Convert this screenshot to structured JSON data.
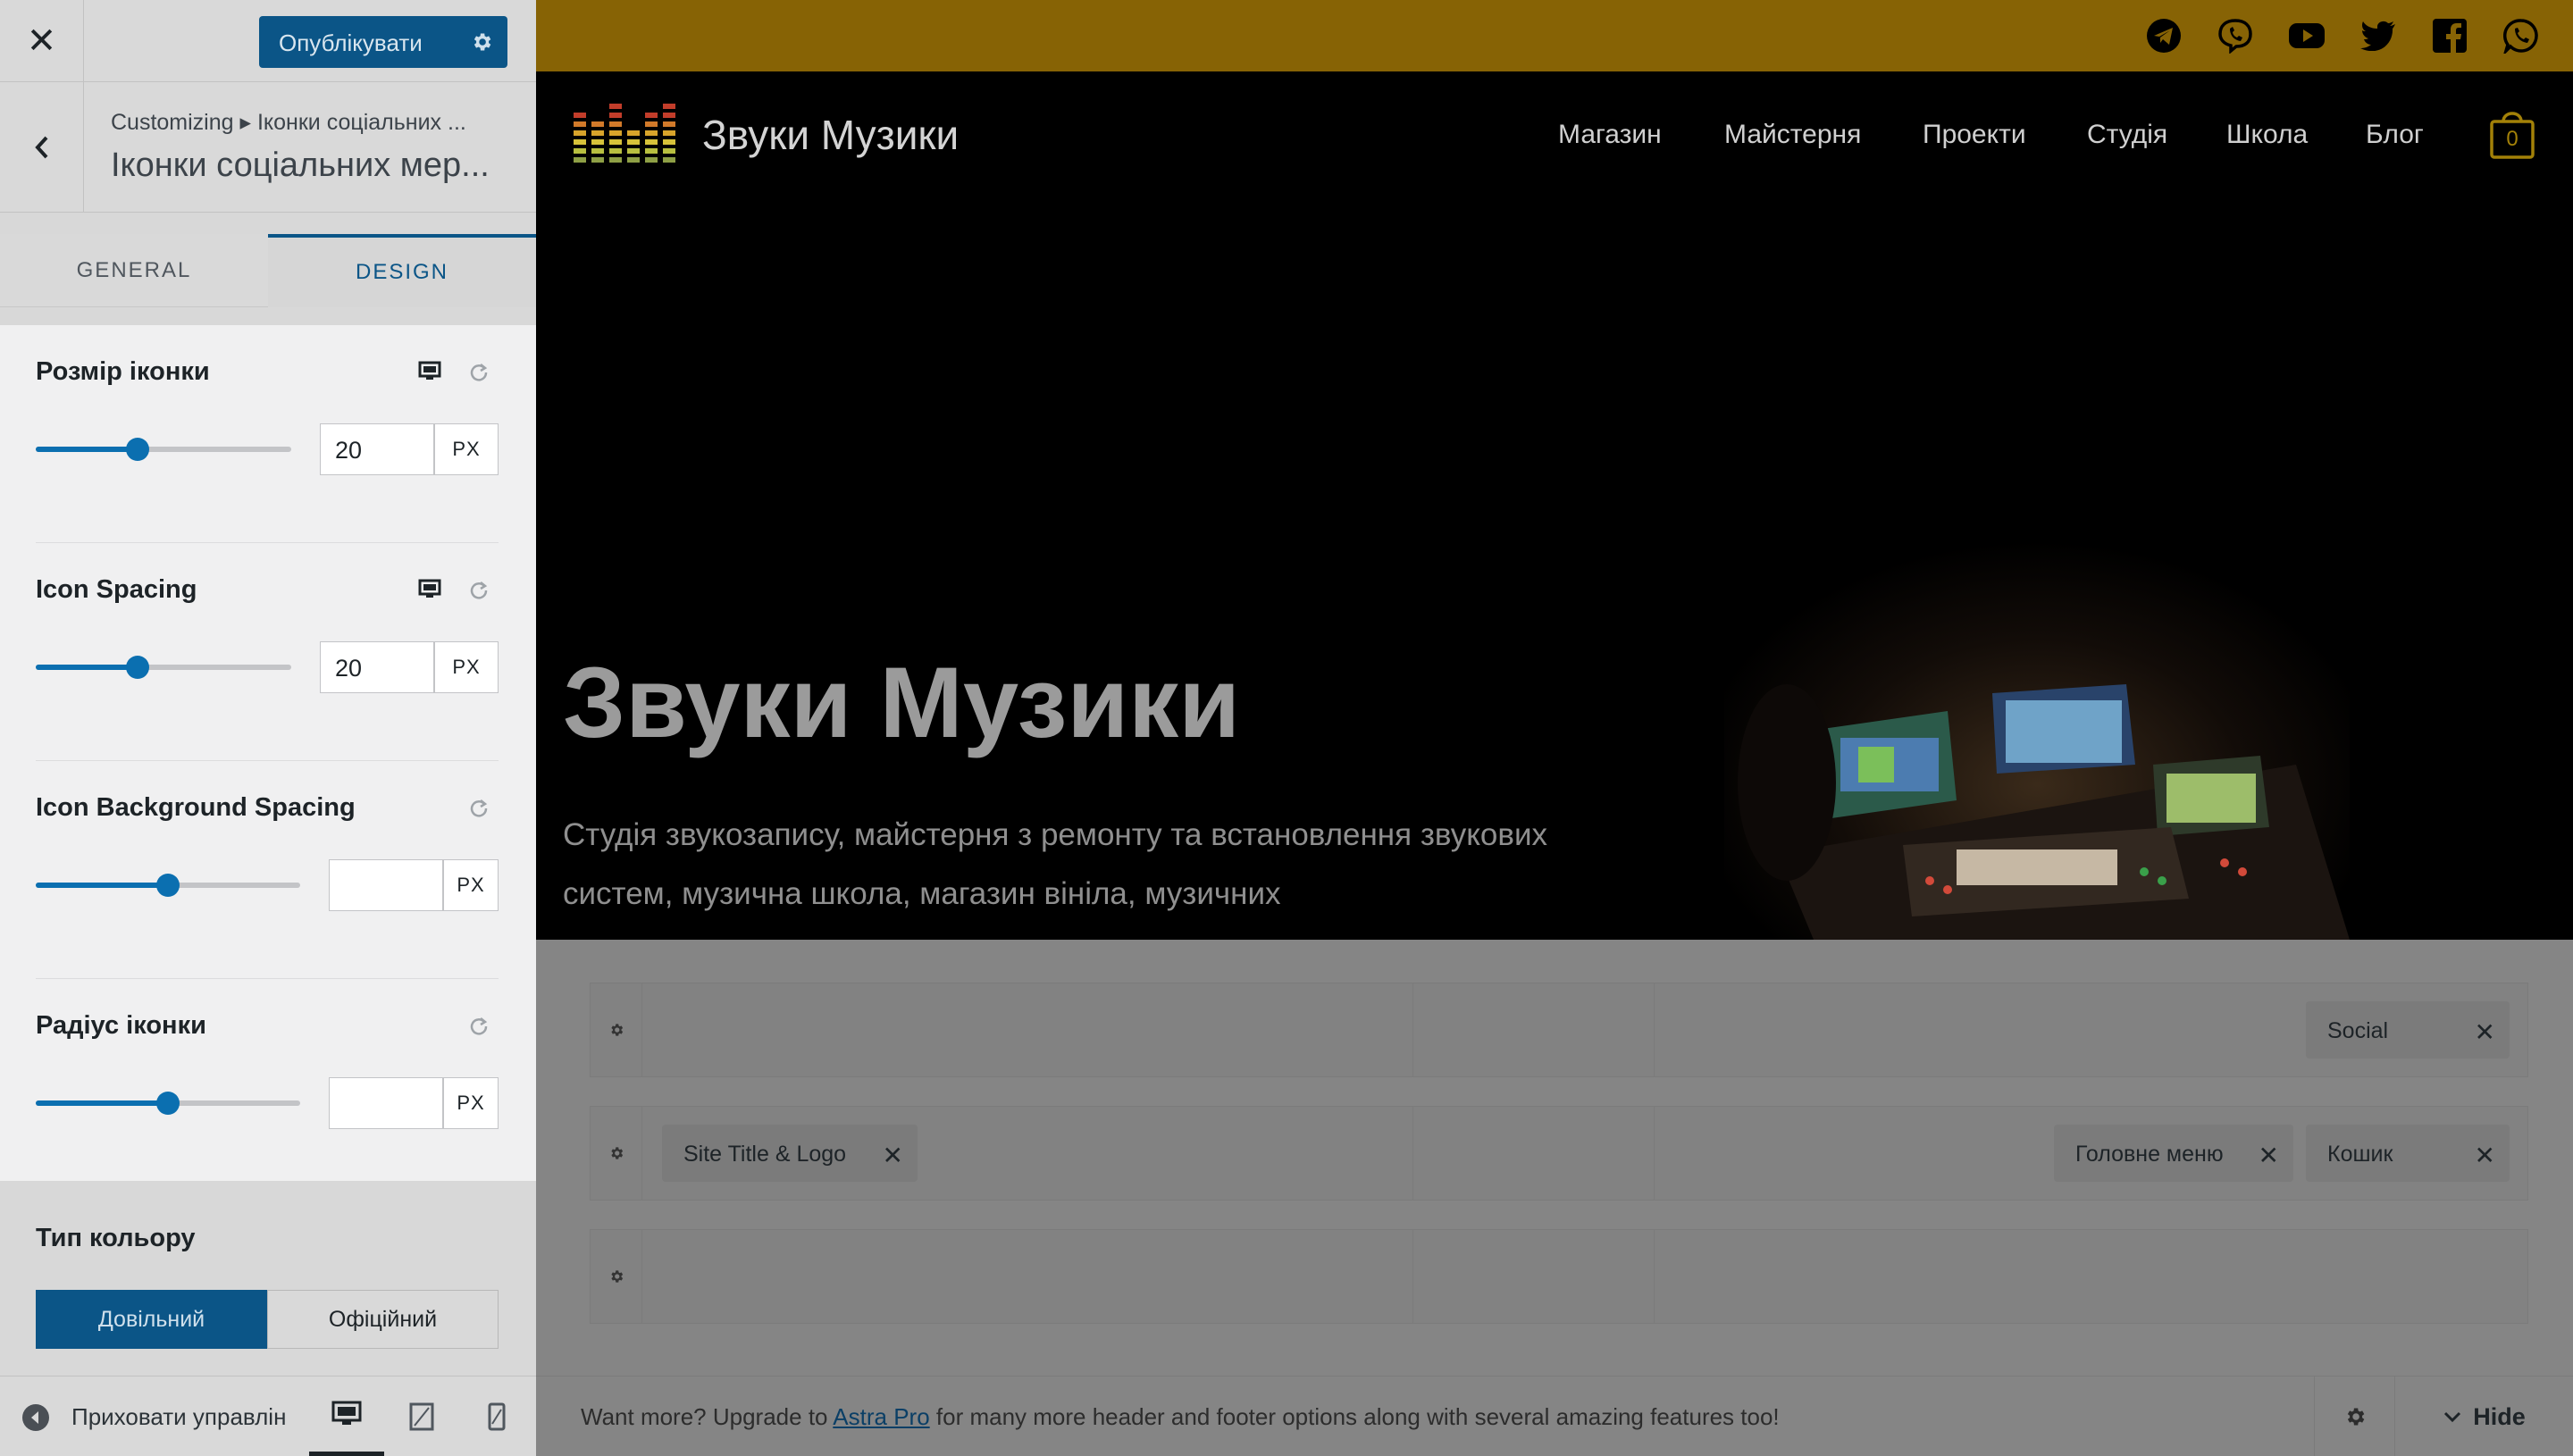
{
  "sidebar": {
    "close_icon": "close-icon",
    "publish_label": "Опублікувати",
    "breadcrumb": "Customizing ▸ Іконки соціальних ...",
    "section_title": "Іконки соціальних мер...",
    "tabs": [
      "GENERAL",
      "DESIGN"
    ],
    "active_tab": "DESIGN",
    "controls": [
      {
        "label": "Розмір іконки",
        "value": "20",
        "unit": "PX",
        "slider_fraction": 0.4,
        "responsive": true
      },
      {
        "label": "Icon Spacing",
        "value": "20",
        "unit": "PX",
        "slider_fraction": 0.4,
        "responsive": true
      },
      {
        "label": "Icon Background Spacing",
        "value": "",
        "unit": "PX",
        "slider_fraction": 0.5,
        "responsive": false
      },
      {
        "label": "Радіус іконки",
        "value": "",
        "unit": "PX",
        "slider_fraction": 0.5,
        "responsive": false
      }
    ],
    "color_type": {
      "label": "Тип кольору",
      "options": [
        "Довільний",
        "Офіційний"
      ],
      "selected": "Довільний"
    },
    "footer": {
      "hide_controls": "Приховати управлін",
      "devices": [
        "desktop",
        "tablet",
        "mobile"
      ],
      "active_device": "desktop"
    }
  },
  "preview": {
    "social_icons": [
      "telegram-icon",
      "viber-icon",
      "youtube-icon",
      "twitter-icon",
      "facebook-icon",
      "whatsapp-icon"
    ],
    "site_title": "Звуки Музики",
    "menu": [
      "Магазин",
      "Майстерня",
      "Проекти",
      "Студія",
      "Школа",
      "Блог"
    ],
    "cart_count": "0",
    "hero": {
      "title": "Звуки Музики",
      "description": "Студія звукозапису, майстерня з ремонту та встановлення звукових систем, музична школа, магазин вініла, музичних"
    },
    "builder": {
      "row1": {
        "right": [
          "Social"
        ]
      },
      "row2": {
        "left": [
          "Site Title & Logo"
        ],
        "right": [
          "Головне меню",
          "Кошик"
        ]
      },
      "row3": {}
    },
    "upgrade": {
      "before": "Want more? Upgrade to ",
      "link": "Astra Pro",
      "after": " for many more header and footer options along with several amazing features too!"
    },
    "hide_label": "Hide"
  },
  "colors": {
    "accent_blue": "#0b5587",
    "topbar_gold": "#876305",
    "cart_gold": "#a38108"
  }
}
